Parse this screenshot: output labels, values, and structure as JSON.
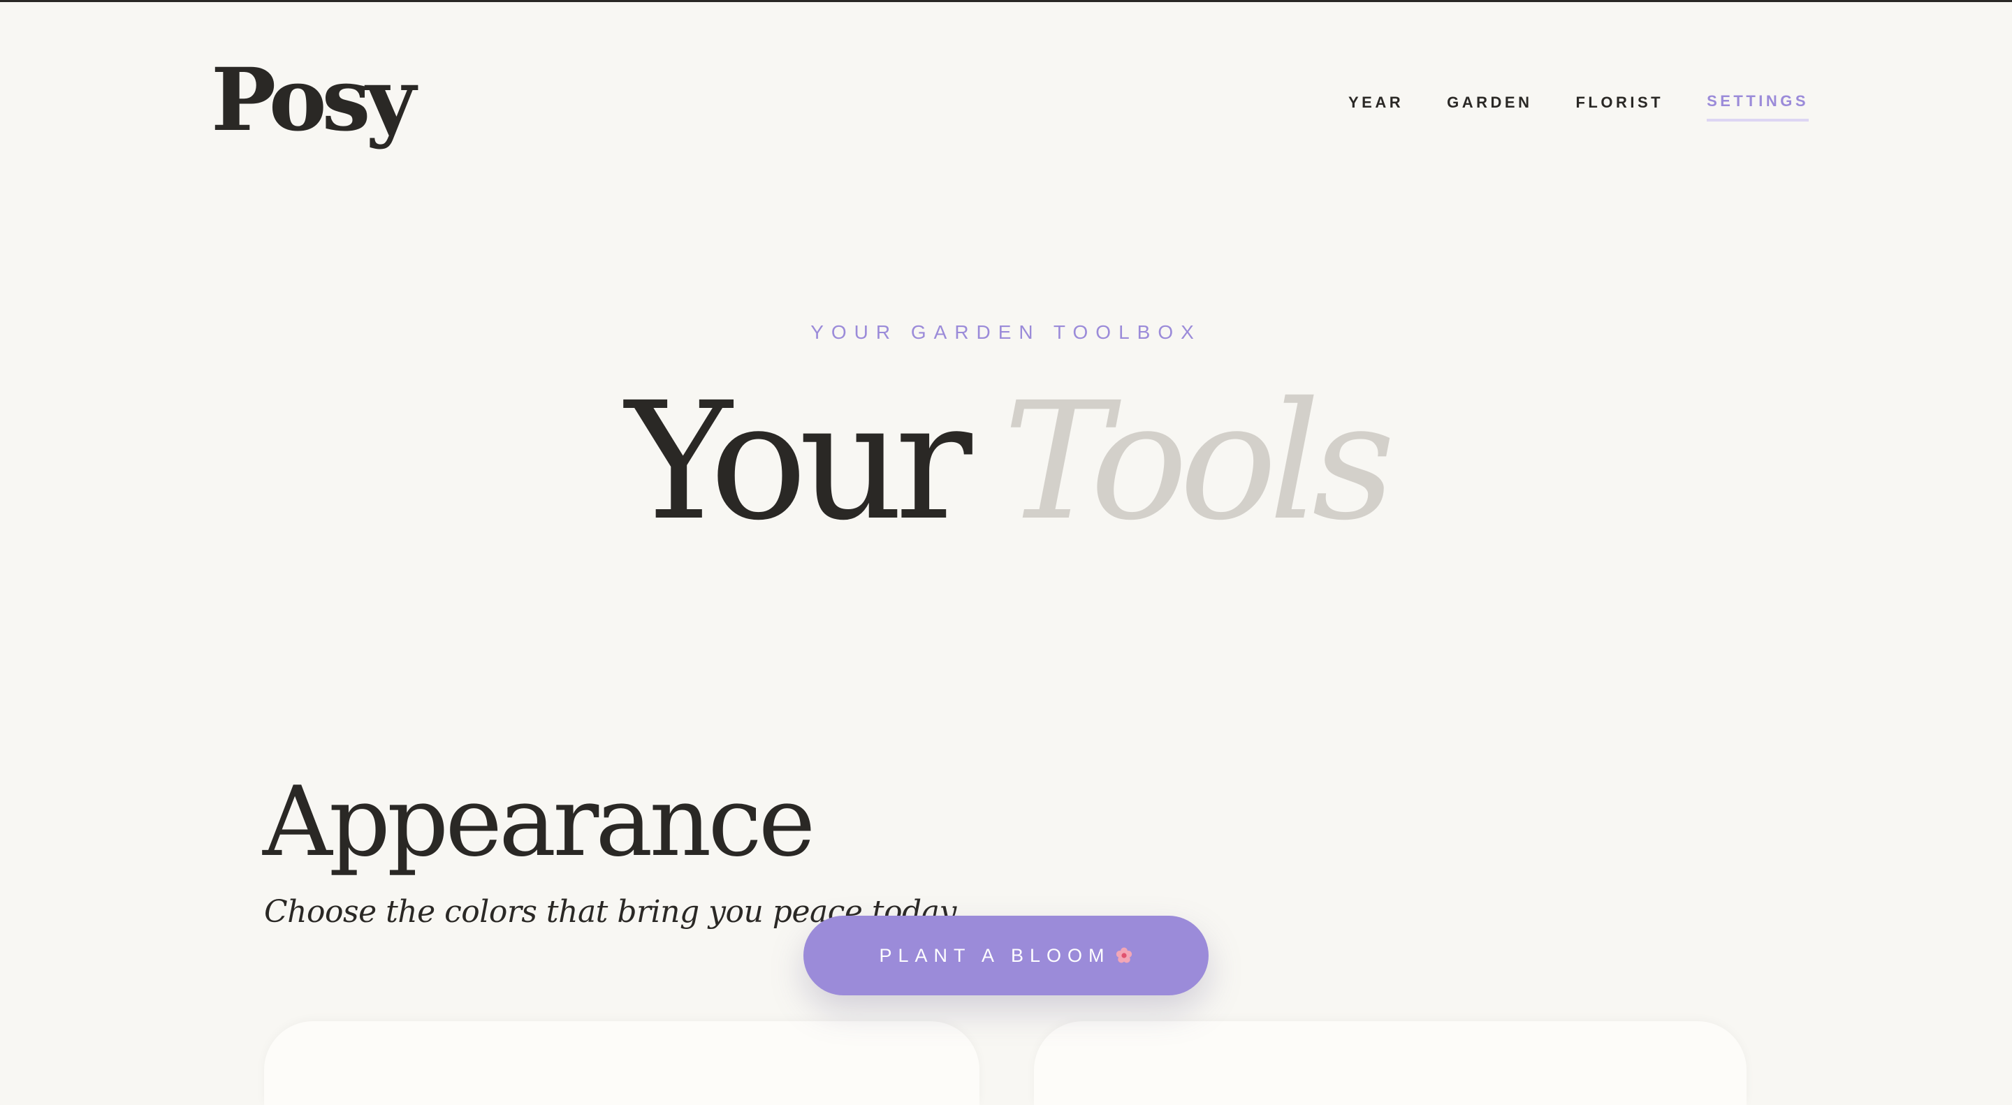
{
  "brand": {
    "logo_text": "Posy"
  },
  "nav": {
    "items": [
      {
        "label": "YEAR"
      },
      {
        "label": "GARDEN"
      },
      {
        "label": "FLORIST"
      },
      {
        "label": "SETTINGS"
      }
    ],
    "active": "SETTINGS"
  },
  "hero": {
    "eyebrow": "YOUR GARDEN TOOLBOX",
    "title_main": "Your",
    "title_accent": "Tools"
  },
  "appearance": {
    "title": "Appearance",
    "subtitle": "Choose the colors that bring you peace today"
  },
  "fab": {
    "label": "PLANT A BLOOM",
    "icon": "flower-icon"
  },
  "colors": {
    "accent": "#9b8bd9",
    "background": "#f8f7f3",
    "text": "#2a2825",
    "muted": "#d3d0ca"
  }
}
